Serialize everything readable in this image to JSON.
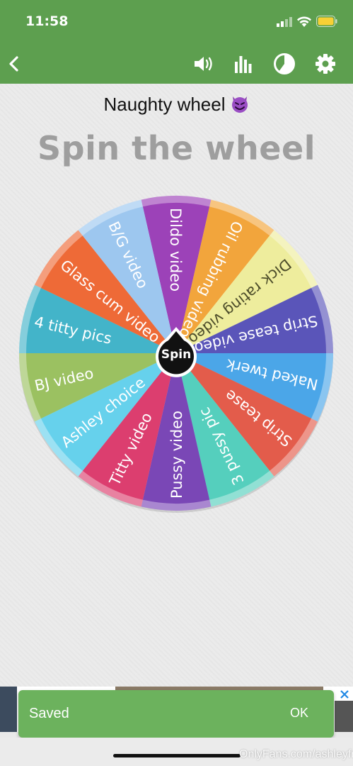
{
  "status_bar": {
    "time": "11:58"
  },
  "toolbar": {
    "back_icon": "chevron-left-icon",
    "sound_icon": "speaker-icon",
    "stats_icon": "bar-chart-icon",
    "pie_icon": "pie-chart-icon",
    "settings_icon": "gear-icon"
  },
  "header": {
    "wheel_name": "Naughty wheel",
    "title": "Spin the wheel"
  },
  "wheel": {
    "spin_label": "Spin",
    "segments": [
      {
        "label": "Dildo video",
        "color": "#9c42b8"
      },
      {
        "label": "Oil rubbing video",
        "color": "#f2a53c"
      },
      {
        "label": "Dick rating video",
        "color": "#eeed9d"
      },
      {
        "label": "Strip tease video",
        "color": "#5a55b9"
      },
      {
        "label": "Naked twerk",
        "color": "#4ba6e8"
      },
      {
        "label": "Strip tease",
        "color": "#e35c4b"
      },
      {
        "label": "3 pussy pic",
        "color": "#55cfbd"
      },
      {
        "label": "Pussy video",
        "color": "#7a47b6"
      },
      {
        "label": "Titty video",
        "color": "#dc3e6f"
      },
      {
        "label": "Ashley choice",
        "color": "#66d1ec"
      },
      {
        "label": "BJ video",
        "color": "#9bc161"
      },
      {
        "label": "4 titty pics",
        "color": "#43b4c9"
      },
      {
        "label": "Glass cum video",
        "color": "#ee6a37"
      },
      {
        "label": "B/G video",
        "color": "#9dc7ef"
      }
    ]
  },
  "snackbar": {
    "message": "Saved",
    "action": "OK"
  },
  "ad": {
    "close_icon": "ad-close-icon"
  },
  "watermark": "OnlyFans.com/ashleyfree"
}
